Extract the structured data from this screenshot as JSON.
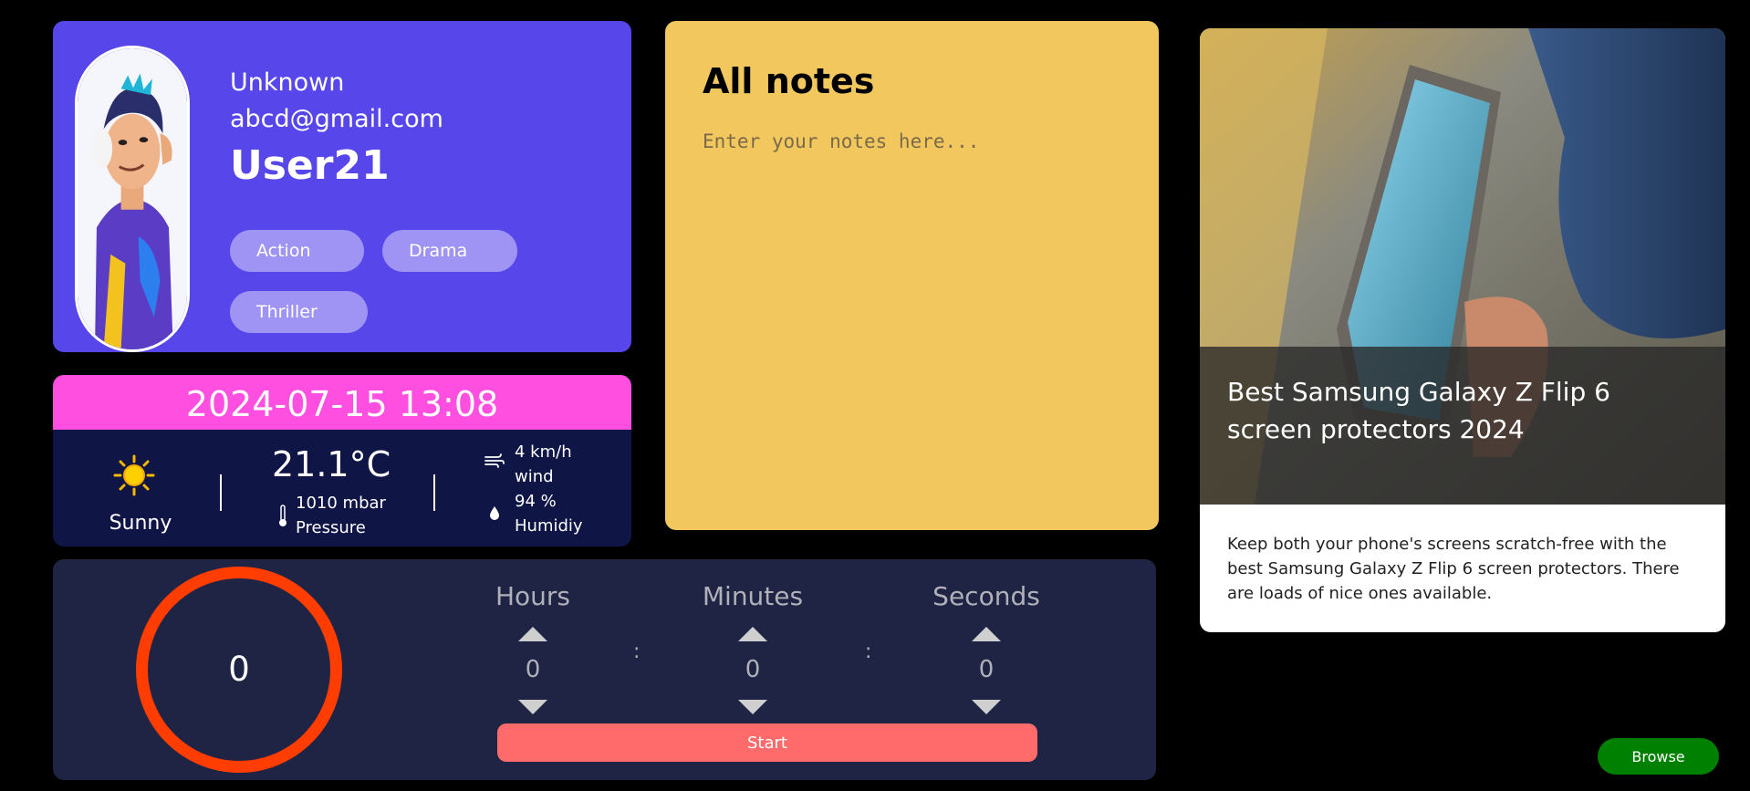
{
  "profile": {
    "name": "Unknown",
    "email": "abcd@gmail.com",
    "username": "User21",
    "genres": [
      "Action",
      "Drama",
      "Thriller"
    ]
  },
  "weather": {
    "datetime": "2024-07-15 13:08",
    "condition": "Sunny",
    "temperature": "21.1°C",
    "pressure_value": "1010 mbar",
    "pressure_label": "Pressure",
    "wind_value": "4 km/h",
    "wind_label": "wind",
    "humidity_value": "94 %",
    "humidity_label": "Humidiy"
  },
  "notes": {
    "title": "All notes",
    "placeholder": "Enter your notes here..."
  },
  "timer": {
    "display": "0",
    "hours_label": "Hours",
    "minutes_label": "Minutes",
    "seconds_label": "Seconds",
    "hours": "0",
    "minutes": "0",
    "seconds": "0",
    "start_label": "Start",
    "ring_color": "#ff3d00"
  },
  "news": {
    "title": "Best Samsung Galaxy Z Flip 6 screen protectors 2024",
    "description": "Keep both your phone's screens scratch-free with the best Samsung Galaxy Z Flip 6 screen protectors. There are loads of nice ones available.",
    "browse_label": "Browse"
  },
  "colors": {
    "profile_bg": "#5746ea",
    "weather_header": "#ff4fe0",
    "notes_bg": "#f1c75e",
    "timer_bg": "#1f2444",
    "start_button": "#ff6b6b",
    "browse_button": "#008000"
  }
}
